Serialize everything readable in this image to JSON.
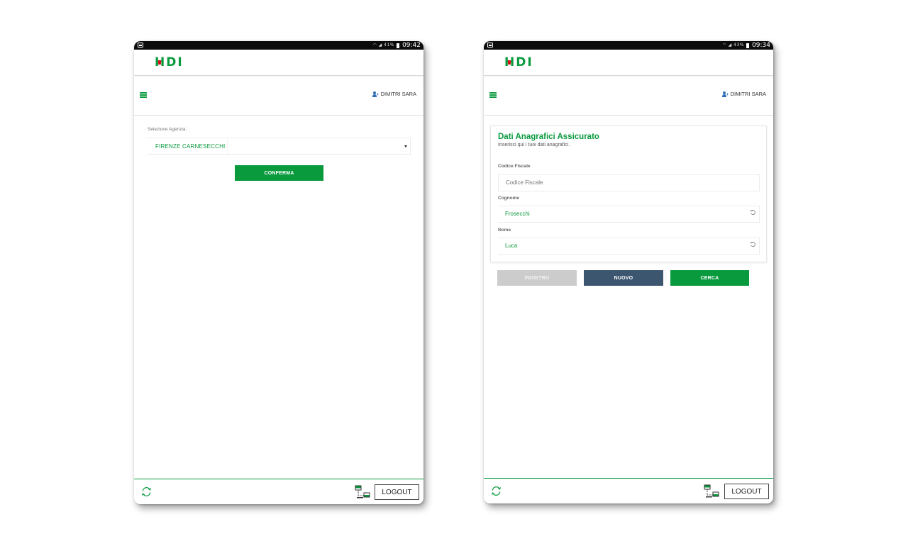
{
  "screens": [
    {
      "status_bar": {
        "signal_text": "41%",
        "time": "09:42"
      },
      "header": {
        "logo": "HDI"
      },
      "nav": {
        "user_name": "DIMITRI SARA"
      },
      "agency": {
        "label": "Selezione Agenzia:",
        "selected_value": "FIRENZE CARNESECCHI",
        "confirm_label": "CONFERMA"
      },
      "footer": {
        "logout_label": "LOGOUT"
      }
    },
    {
      "status_bar": {
        "signal_text": "43%",
        "time": "09:34"
      },
      "header": {
        "logo": "HDI"
      },
      "nav": {
        "user_name": "DIMITRI SARA"
      },
      "form": {
        "title": "Dati Anagrafici Assicurato",
        "subtitle": "Inserisci qui i tuoi dati anagrafici.",
        "fields": [
          {
            "label": "Codice Fiscale",
            "value": "",
            "placeholder": "Codice Fiscale"
          },
          {
            "label": "Cognome",
            "value": "Frosecchi",
            "placeholder": ""
          },
          {
            "label": "Nome",
            "value": "Luca",
            "placeholder": ""
          }
        ]
      },
      "actions": {
        "back_label": "INDIETRO",
        "new_label": "NUOVO",
        "search_label": "CERCA"
      },
      "footer": {
        "logout_label": "LOGOUT"
      }
    }
  ],
  "colors": {
    "brand_green": "#0a9a3e",
    "brand_red": "#d7141a",
    "new_button": "#3c5670",
    "disabled_button": "#cccccc",
    "user_icon": "#2f6db5"
  },
  "icons": [
    "notification-icon",
    "wifi-icon",
    "signal-icon",
    "battery-icon",
    "menu-icon",
    "user-add-icon",
    "dropdown-caret-icon",
    "refresh-icon",
    "network-icon",
    "undo-icon"
  ]
}
